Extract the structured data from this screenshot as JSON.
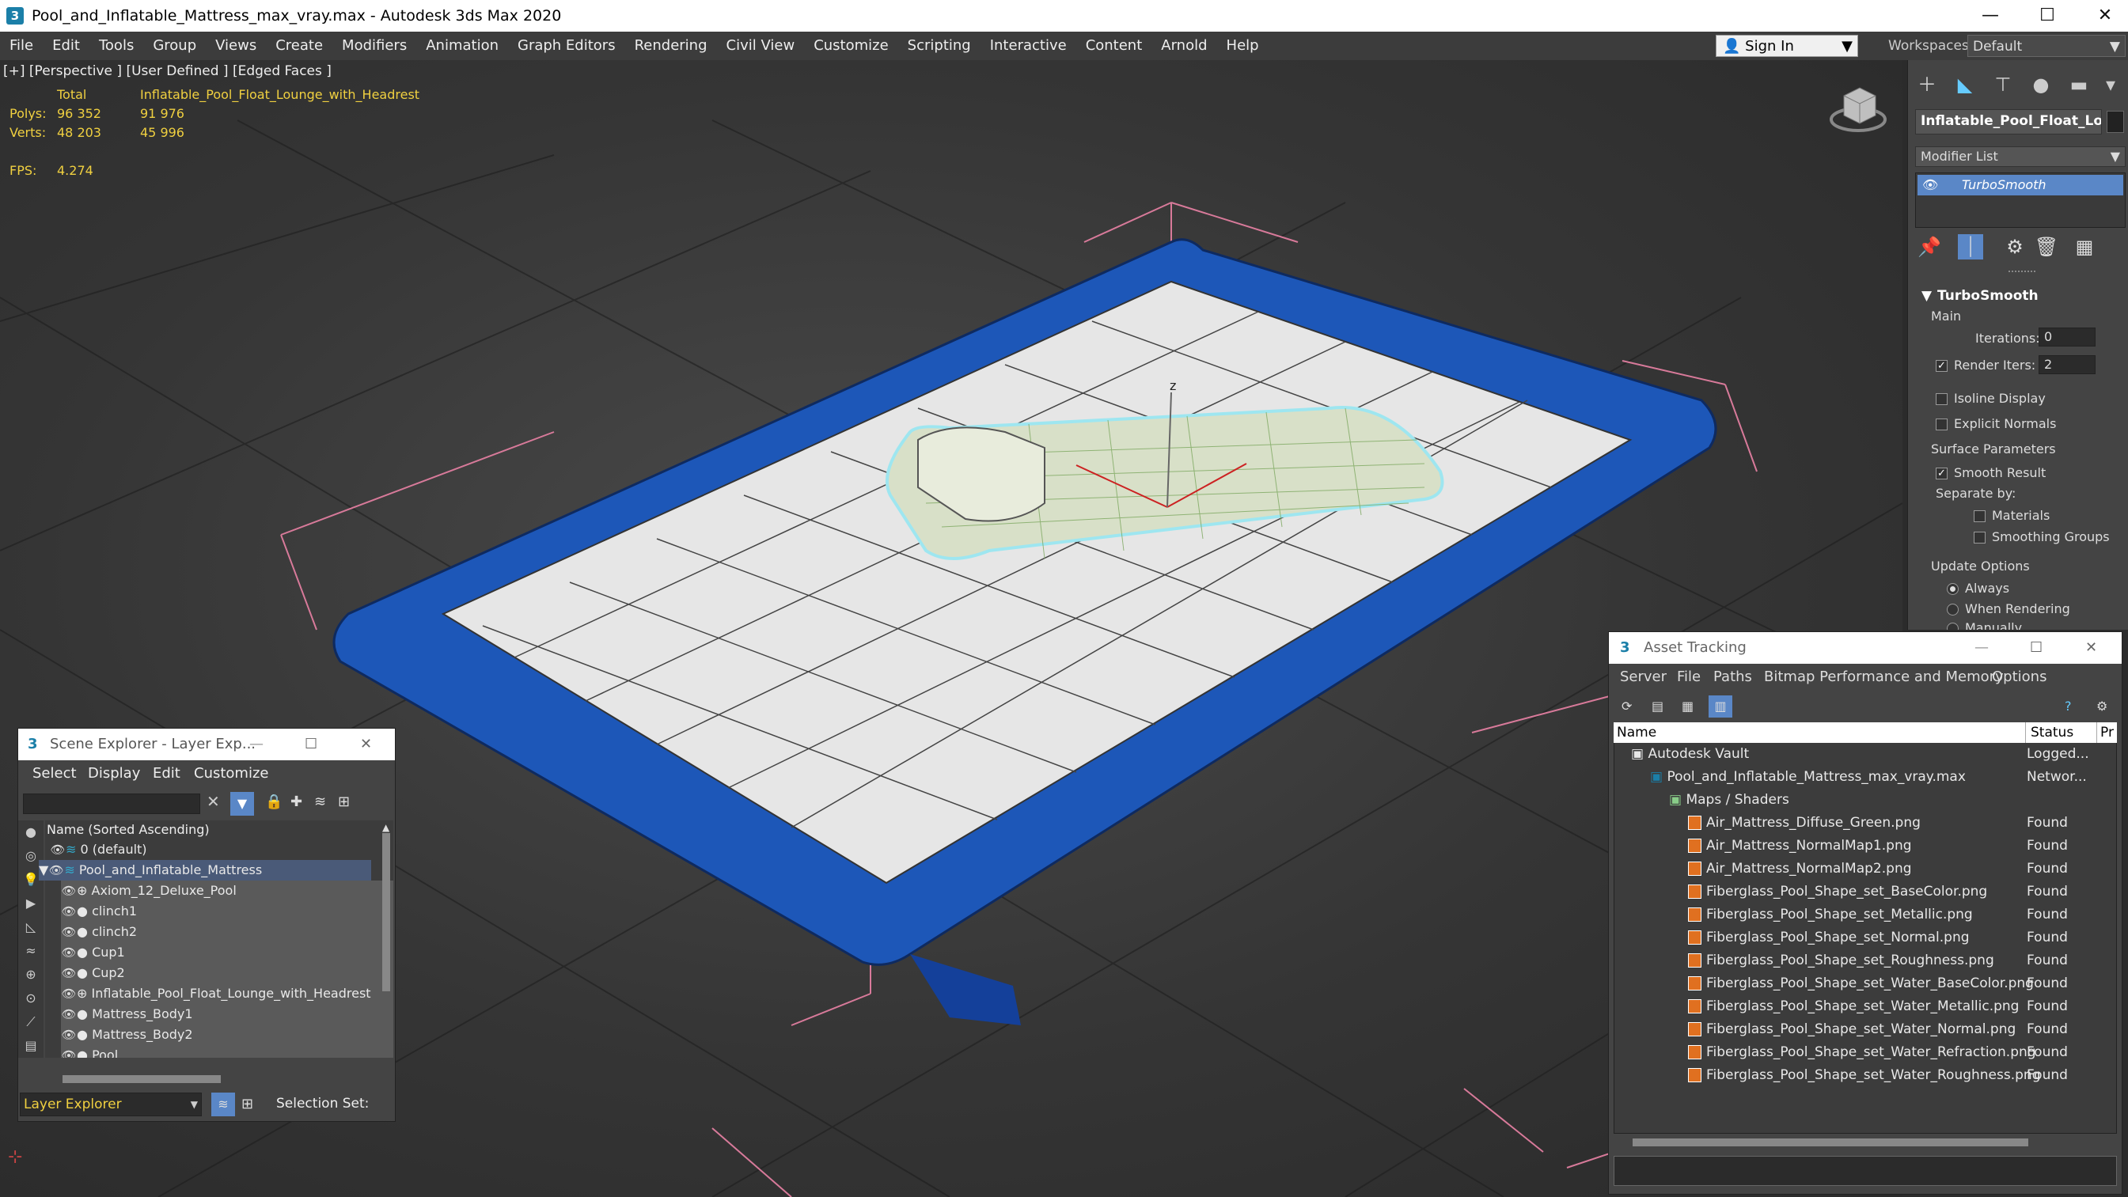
{
  "window": {
    "title": "Pool_and_Inflatable_Mattress_max_vray.max - Autodesk 3ds Max 2020"
  },
  "menu": [
    "File",
    "Edit",
    "Tools",
    "Group",
    "Views",
    "Create",
    "Modifiers",
    "Animation",
    "Graph Editors",
    "Rendering",
    "Civil View",
    "Customize",
    "Scripting",
    "Interactive",
    "Content",
    "Arnold",
    "Help"
  ],
  "signin": "Sign In",
  "workspaces": {
    "label": "Workspaces:",
    "value": "Default"
  },
  "viewport": {
    "label": "[+] [Perspective ] [User Defined ] [Edged Faces ]",
    "stats": {
      "total_label": "Total",
      "object_name": "Inflatable_Pool_Float_Lounge_with_Headrest",
      "polys_label": "Polys:",
      "polys_total": "96 352",
      "polys_obj": "91 976",
      "verts_label": "Verts:",
      "verts_total": "48 203",
      "verts_obj": "45 996",
      "fps_label": "FPS:",
      "fps_value": "4.274"
    },
    "axis_z": "z"
  },
  "command_panel": {
    "object_name": "Inflatable_Pool_Float_Loun",
    "modifier_list": "Modifier List",
    "modifier": "TurboSmooth",
    "rollout": "TurboSmooth",
    "main": "Main",
    "iterations_label": "Iterations:",
    "iterations_value": "0",
    "render_iters_label": "Render Iters:",
    "render_iters_value": "2",
    "isoline": "Isoline Display",
    "explicit_normals": "Explicit Normals",
    "surface_params": "Surface Parameters",
    "smooth_result": "Smooth Result",
    "separate_by": "Separate by:",
    "materials": "Materials",
    "smoothing_groups": "Smoothing Groups",
    "update_options": "Update Options",
    "always": "Always",
    "when_rendering": "When Rendering",
    "manually": "Manually"
  },
  "scene_explorer": {
    "title": "Scene Explorer - Layer Exp...",
    "menu": [
      "Select",
      "Display",
      "Edit",
      "Customize"
    ],
    "column": "Name (Sorted Ascending)",
    "rows": [
      "0 (default)",
      "Pool_and_Inflatable_Mattress",
      "Axiom_12_Deluxe_Pool",
      "clinch1",
      "clinch2",
      "Cup1",
      "Cup2",
      "Inflatable_Pool_Float_Lounge_with_Headrest",
      "Mattress_Body1",
      "Mattress_Body2",
      "Pool"
    ],
    "footer_select": "Layer Explorer",
    "selection_set": "Selection Set:"
  },
  "asset_tracking": {
    "title": "Asset Tracking",
    "menu": [
      "Server",
      "File",
      "Paths",
      "Bitmap Performance and Memory",
      "Options"
    ],
    "col_name": "Name",
    "col_status": "Status",
    "col_pr": "Pr",
    "rows": [
      {
        "name": "Autodesk Vault",
        "status": "Logged..."
      },
      {
        "name": "Pool_and_Inflatable_Mattress_max_vray.max",
        "status": "Networ..."
      },
      {
        "name": "Maps / Shaders",
        "status": ""
      },
      {
        "name": "Air_Mattress_Diffuse_Green.png",
        "status": "Found"
      },
      {
        "name": "Air_Mattress_NormalMap1.png",
        "status": "Found"
      },
      {
        "name": "Air_Mattress_NormalMap2.png",
        "status": "Found"
      },
      {
        "name": "Fiberglass_Pool_Shape_set_BaseColor.png",
        "status": "Found"
      },
      {
        "name": "Fiberglass_Pool_Shape_set_Metallic.png",
        "status": "Found"
      },
      {
        "name": "Fiberglass_Pool_Shape_set_Normal.png",
        "status": "Found"
      },
      {
        "name": "Fiberglass_Pool_Shape_set_Roughness.png",
        "status": "Found"
      },
      {
        "name": "Fiberglass_Pool_Shape_set_Water_BaseColor.png",
        "status": "Found"
      },
      {
        "name": "Fiberglass_Pool_Shape_set_Water_Metallic.png",
        "status": "Found"
      },
      {
        "name": "Fiberglass_Pool_Shape_set_Water_Normal.png",
        "status": "Found"
      },
      {
        "name": "Fiberglass_Pool_Shape_set_Water_Refraction.png",
        "status": "Found"
      },
      {
        "name": "Fiberglass_Pool_Shape_set_Water_Roughness.png",
        "status": "Found"
      }
    ]
  }
}
